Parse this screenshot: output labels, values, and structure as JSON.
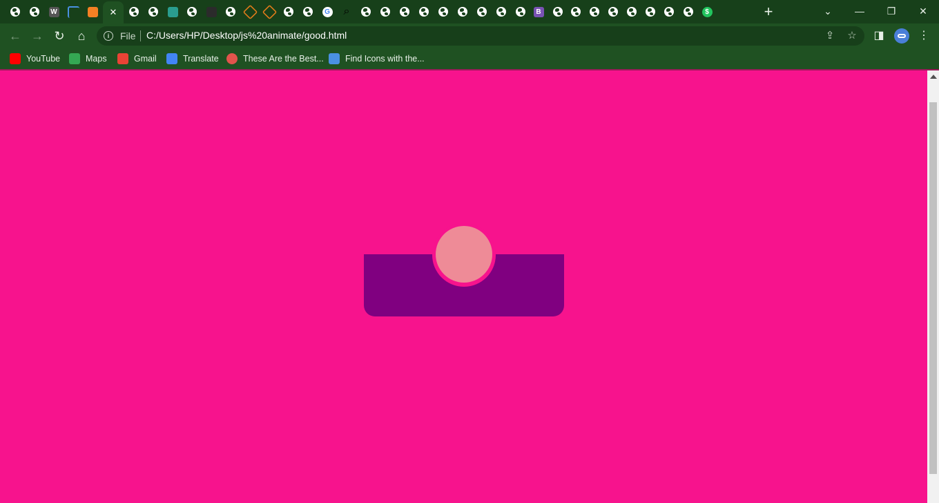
{
  "browser": {
    "tabs": [
      {
        "icon": "globe-icon"
      },
      {
        "icon": "globe-icon"
      },
      {
        "icon": "wiki-icon",
        "glyph": "W"
      },
      {
        "icon": "flag-icon"
      },
      {
        "icon": "stackoverflow-icon"
      },
      {
        "icon": "close-icon",
        "active": true
      },
      {
        "icon": "globe-icon"
      },
      {
        "icon": "globe-icon"
      },
      {
        "icon": "edit-icon"
      },
      {
        "icon": "globe-icon"
      },
      {
        "icon": "github-icon"
      },
      {
        "icon": "globe-icon"
      },
      {
        "icon": "diamond-icon"
      },
      {
        "icon": "diamond-icon"
      },
      {
        "icon": "globe-icon"
      },
      {
        "icon": "globe-icon"
      },
      {
        "icon": "google-icon",
        "glyph": "G"
      },
      {
        "icon": "search-icon"
      },
      {
        "icon": "globe-icon"
      },
      {
        "icon": "globe-icon"
      },
      {
        "icon": "globe-icon"
      },
      {
        "icon": "globe-icon"
      },
      {
        "icon": "globe-icon"
      },
      {
        "icon": "globe-icon"
      },
      {
        "icon": "globe-icon"
      },
      {
        "icon": "globe-icon"
      },
      {
        "icon": "globe-icon"
      },
      {
        "icon": "bootstrap-icon",
        "glyph": "B"
      },
      {
        "icon": "globe-icon"
      },
      {
        "icon": "globe-icon"
      },
      {
        "icon": "globe-icon"
      },
      {
        "icon": "globe-icon"
      },
      {
        "icon": "globe-icon"
      },
      {
        "icon": "globe-icon"
      },
      {
        "icon": "globe-icon"
      },
      {
        "icon": "globe-icon"
      },
      {
        "icon": "dollar-icon",
        "glyph": "$"
      }
    ],
    "new_tab_glyph": "+",
    "window": {
      "minimize": "—",
      "restore": "❐",
      "close": "✕",
      "tab_search": "⌄"
    },
    "address": {
      "file_label": "File",
      "url": "C:/Users/HP/Desktop/js%20animate/good.html"
    },
    "bookmarks": [
      {
        "label": "YouTube",
        "icon": "youtube-icon",
        "color": "#ff0000"
      },
      {
        "label": "Maps",
        "icon": "maps-icon",
        "color": "#34a853"
      },
      {
        "label": "Gmail",
        "icon": "gmail-icon",
        "color": "#ea4335"
      },
      {
        "label": "Translate",
        "icon": "translate-icon",
        "color": "#4285f4"
      },
      {
        "label": "These Are the Best...",
        "icon": "brush-icon",
        "color": "#e2544c"
      },
      {
        "label": "Find Icons with the...",
        "icon": "flag-icon",
        "color": "#4a90e2"
      }
    ]
  },
  "page": {
    "background": "#f7138d",
    "nav_card_color": "#800080",
    "indicator_color": "#ee8b97"
  }
}
